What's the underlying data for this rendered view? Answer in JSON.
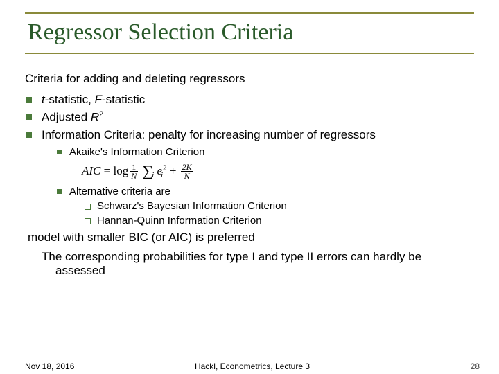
{
  "title": "Regressor Selection Criteria",
  "intro": "Criteria for adding and deleting regressors",
  "items": {
    "i0": {
      "pre": "",
      "it": "t",
      "mid": "-statistic, ",
      "it2": "F",
      "post": "-statistic"
    },
    "i1": {
      "pre": "Adjusted ",
      "it": "R",
      "sup": "2"
    },
    "i2": {
      "text": "Information Criteria: penalty for increasing number of regressors"
    }
  },
  "sub": {
    "s0": "Akaike's Information Criterion",
    "s1": "Alternative criteria are"
  },
  "subsub": {
    "ss0": "Schwarz's Bayesian Information Criterion",
    "ss1": "Hannan-Quinn Information Criterion"
  },
  "formula": {
    "aic": "AIC",
    "eq": " = log",
    "frac1num": "1",
    "frac1den": "N",
    "sum_sub": "i",
    "e": "e",
    "e_sub": "i",
    "e_sup": "2",
    "plus": " + ",
    "frac2num": "2K",
    "frac2den": "N"
  },
  "closing1": "model  with smaller BIC (or AIC) is preferred",
  "closing2": "The corresponding probabilities for type I and type II errors can hardly be assessed",
  "footer": {
    "date": "Nov 18, 2016",
    "center": "Hackl,  Econometrics, Lecture 3",
    "page": "28"
  }
}
